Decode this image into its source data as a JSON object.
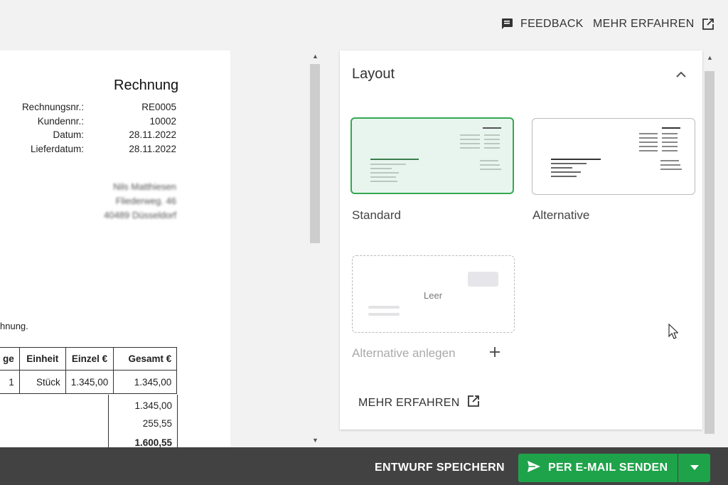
{
  "header": {
    "feedback_label": "FEEDBACK",
    "learn_more_label": "MEHR ERFAHREN"
  },
  "document": {
    "title": "Rechnung",
    "meta_labels": [
      "Rechnungsnr.:",
      "Kundennr.:",
      "Datum:",
      "Lieferdatum:"
    ],
    "meta_values": [
      "RE0005",
      "10002",
      "28.11.2022",
      "28.11.2022"
    ],
    "recipient_lines": [
      "Nils Matthiesen",
      "Fliederweg. 46",
      "40489 Düsseldorf"
    ],
    "intro_text": "hnung.",
    "table": {
      "headers": [
        "ge",
        "Einheit",
        "Einzel €",
        "Gesamt €"
      ],
      "row": [
        "1",
        "Stück",
        "1.345,00",
        "1.345,00"
      ]
    },
    "totals": [
      "1.345,00",
      "255,55",
      "1.600,55"
    ]
  },
  "layout_panel": {
    "title": "Layout",
    "options": [
      {
        "label": "Standard",
        "selected": true
      },
      {
        "label": "Alternative",
        "selected": false
      }
    ],
    "empty_card_label": "Leer",
    "add_alternative_label": "Alternative anlegen",
    "learn_more_label": "MEHR ERFAHREN"
  },
  "footer": {
    "save_draft_label": "ENTWURF SPEICHERN",
    "send_email_label": "PER E-MAIL SENDEN"
  },
  "colors": {
    "accent": "#1fa34a",
    "selected_card_bg": "#e8f5ee",
    "bottom_bar": "#424242"
  }
}
